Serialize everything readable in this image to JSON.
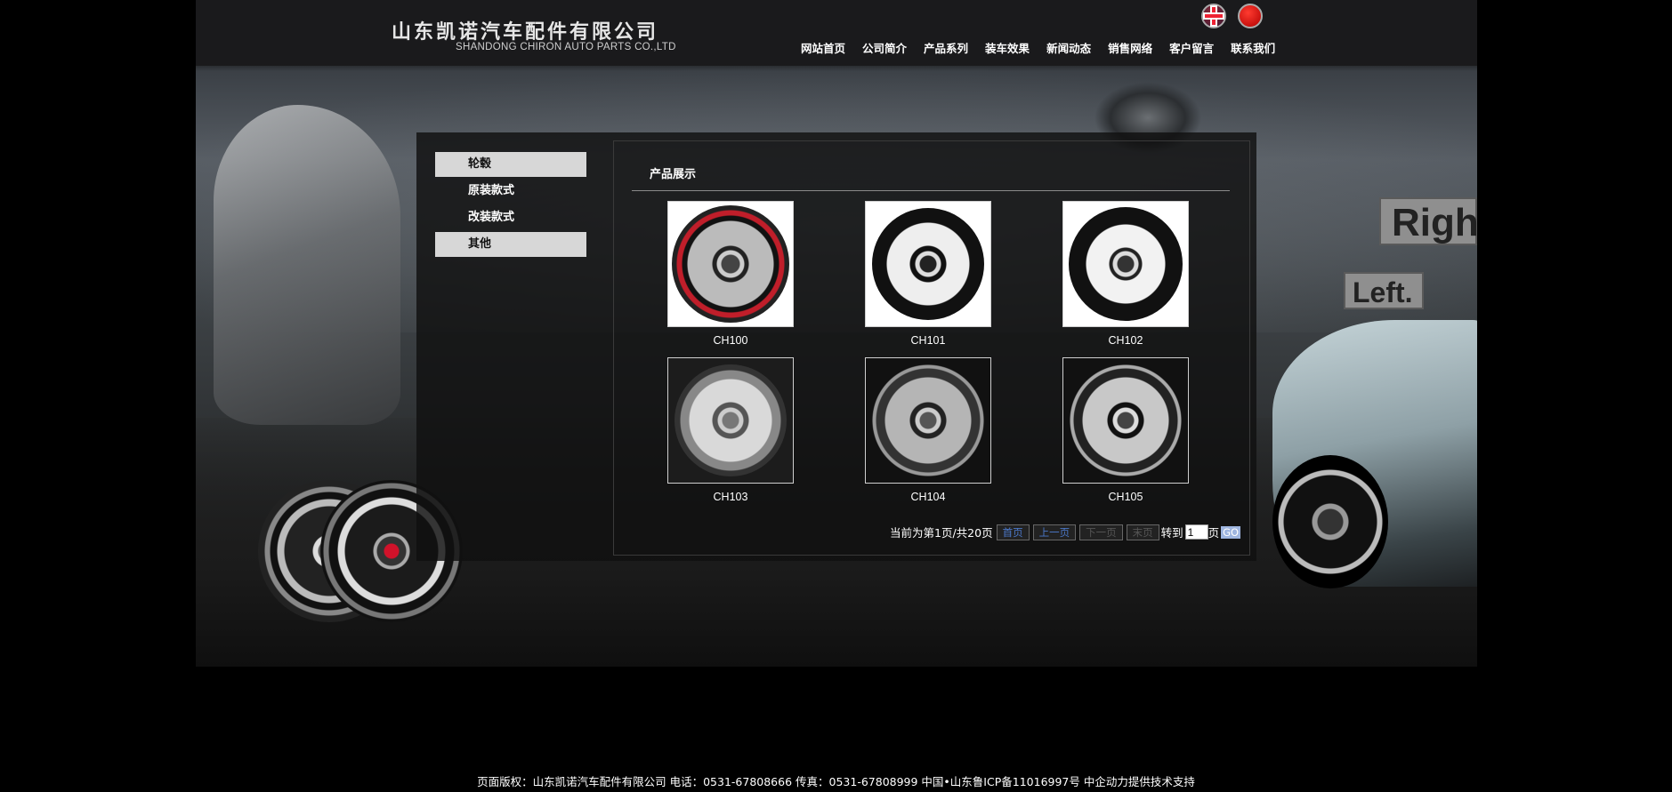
{
  "header": {
    "company_cn": "山东凯诺汽车配件有限公司",
    "company_en": "SHANDONG CHIRON AUTO PARTS CO.,LTD",
    "language_icons": [
      "uk-flag-icon",
      "china-flag-icon"
    ],
    "nav": [
      "网站首页",
      "公司简介",
      "产品系列",
      "装车效果",
      "新闻动态",
      "销售网络",
      "客户留言",
      "联系我们"
    ]
  },
  "sidebar": {
    "items": [
      {
        "label": "轮毂",
        "highlighted": true
      },
      {
        "label": "原装款式",
        "highlighted": false
      },
      {
        "label": "改装款式",
        "highlighted": false
      },
      {
        "label": "其他",
        "highlighted": true
      }
    ]
  },
  "panel": {
    "title": "产品展示",
    "products": [
      "CH100",
      "CH101",
      "CH102",
      "CH103",
      "CH104",
      "CH105"
    ]
  },
  "pager": {
    "status": "当前为第1页/共20页",
    "first": "首页",
    "prev": "上一页",
    "next": "下一页",
    "last": "末页",
    "goto": "转到",
    "page_value": "1",
    "page_unit": "页",
    "go": "GO"
  },
  "background": {
    "sign_right": "Righ",
    "sign_left": "Left."
  },
  "footer": {
    "text": "页面版权：山东凯诺汽车配件有限公司 电话：0531-67808666 传真：0531-67808999 中国•山东鲁ICP备11016997号 中企动力提供技术支持"
  },
  "colors": {
    "page_bg": "#000000",
    "sidebar_highlight": "#d7d7d7",
    "pager_link": "#4b78c9"
  }
}
